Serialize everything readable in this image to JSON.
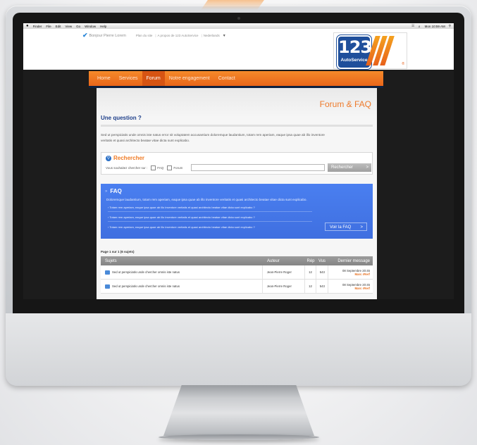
{
  "menubar": {
    "items": [
      "Finder",
      "File",
      "Edit",
      "View",
      "Go",
      "Window",
      "Help"
    ],
    "clock": "Mon 10:59 AM",
    "status_icons": [
      "wifi-icon",
      "volume-icon",
      "spotlight-icon"
    ]
  },
  "header": {
    "greeting": "Bonjour Pierre Lorem",
    "links": [
      "Plan du site",
      "A propos de 123 AutoService",
      "Nederlands"
    ]
  },
  "logo": {
    "number": "123",
    "name": "AutoService",
    "mark": "®"
  },
  "nav": {
    "items": [
      "Home",
      "Services",
      "Forum",
      "Notre engagement",
      "Contact"
    ],
    "active": "Forum"
  },
  "page": {
    "title": "Forum & FAQ",
    "section_title": "Une question ?",
    "intro": "Sed ut perspiciatis unde omnis iste natus error sit voluptatem accusantium doloremque laudantium, totam rem aperiam, eaque ipsa quae ab illo inventore veritatis et quasi architecto beatae vitae dicta sunt explicabo."
  },
  "search": {
    "title": "Rechercher",
    "label": "Vous souhaitez chercher sur :",
    "option_faq": "FAQ",
    "option_forum": "Forum",
    "button": "Rechercher",
    "input_value": ""
  },
  "faq": {
    "title": "FAQ",
    "description": "Doloremque laudantium, totam rem aperiam, eaque ipsa quae ab illo inventore veritatis et quasi architecto beatae vitae dicta sunt explicabo.",
    "questions": [
      "Totam rem aperiam, eaque ipsa quae ab illo inventore veritatis et quasi architecto beatae vitae dicta sunt explicabo ?",
      "Totam rem aperiam, eaque ipsa quae ab illo inventore veritatis et quasi architecto beatae vitae dicta sunt explicabo ?",
      "Totam rem aperiam, eaque ipsa quae ab illo inventore veritatis et quasi architecto beatae vitae dicta sunt explicabo ?"
    ],
    "button": "Voir la FAQ"
  },
  "forum": {
    "pagination": "Page 1 sur 1 (6 sujets)",
    "headers": {
      "subject": "Sujets",
      "author": "Auteur",
      "replies": "Rép",
      "views": "Vus",
      "last": "Dernier message"
    },
    "rows": [
      {
        "subject": "Sed ut perspiciatis unde chercher omnis iste natus",
        "author": "Jean-Pierre Roger",
        "replies": "12",
        "views": "543",
        "last_date": "08 Septembre 20:45",
        "last_user": "Marc rRerf"
      },
      {
        "subject": "Sed ut perspiciatis unde chercher omnis iste natus",
        "author": "Jean-Pierre Roger",
        "replies": "12",
        "views": "543",
        "last_date": "08 Septembre 20:45",
        "last_user": "Marc rRerf"
      }
    ]
  }
}
